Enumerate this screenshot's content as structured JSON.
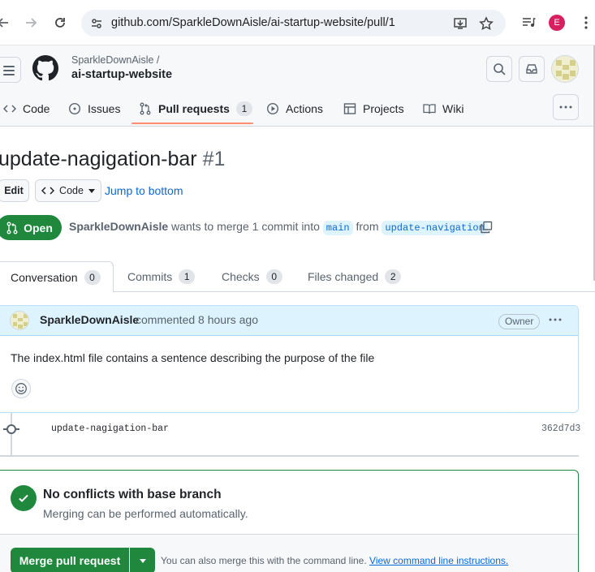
{
  "browser": {
    "url": "github.com/SparkleDownAisle/ai-startup-website/pull/1",
    "profile_initial": "E"
  },
  "repo": {
    "owner": "SparkleDownAisle /",
    "name": "ai-startup-website"
  },
  "repo_tabs": [
    {
      "label": "Code"
    },
    {
      "label": "Issues"
    },
    {
      "label": "Pull requests",
      "count": "1"
    },
    {
      "label": "Actions"
    },
    {
      "label": "Projects"
    },
    {
      "label": "Wiki"
    }
  ],
  "pr": {
    "title": "update-nagigation-bar",
    "number": "#1",
    "edit_label": "Edit",
    "code_label": "Code",
    "jump_label": "Jump to bottom",
    "state": "Open",
    "author": "SparkleDownAisle",
    "merge_text": "wants to merge 1 commit into",
    "base_branch": "main",
    "from_text": "from",
    "head_branch": "update-navigation"
  },
  "pr_tabs": [
    {
      "label": "Conversation",
      "count": "0"
    },
    {
      "label": "Commits",
      "count": "1"
    },
    {
      "label": "Checks",
      "count": "0"
    },
    {
      "label": "Files changed",
      "count": "2"
    }
  ],
  "comment": {
    "author": "SparkleDownAisle",
    "time": "commented 8 hours ago",
    "badge": "Owner",
    "body": "The index.html file contains a sentence describing the purpose of the file"
  },
  "commit": {
    "message": "update-nagigation-bar",
    "sha": "362d7d3"
  },
  "merge_box": {
    "title": "No conflicts with base branch",
    "subtitle": "Merging can be performed automatically.",
    "button": "Merge pull request",
    "cli_text": "You can also merge this with the command line.",
    "cli_link": "View command line instructions."
  },
  "colors": {
    "accent_green": "#1f883d",
    "link_blue": "#0969da",
    "tab_underline": "#fd8c73",
    "comment_header": "#ddf4ff"
  }
}
